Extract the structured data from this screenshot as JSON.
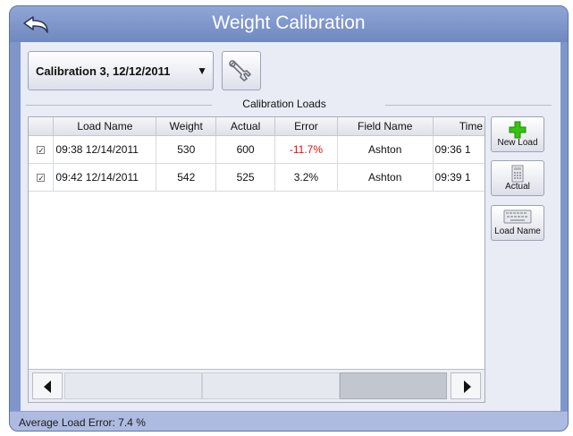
{
  "title": "Weight Calibration",
  "calibration_select": {
    "value": "Calibration 3, 12/12/2011"
  },
  "section_label": "Calibration Loads",
  "table": {
    "columns": [
      "",
      "Load Name",
      "Weight",
      "Actual",
      "Error",
      "Field Name",
      "Time"
    ],
    "rows": [
      {
        "checked": true,
        "load_name": "09:38 12/14/2011",
        "weight": "530",
        "actual": "600",
        "error": "-11.7%",
        "field_name": "Ashton",
        "time": "09:36 1"
      },
      {
        "checked": true,
        "load_name": "09:42 12/14/2011",
        "weight": "542",
        "actual": "525",
        "error": "3.2%",
        "field_name": "Ashton",
        "time": "09:39 1"
      }
    ]
  },
  "side_buttons": {
    "new_load": "New Load",
    "actual": "Actual",
    "load_name": "Load Name"
  },
  "status": "Average Load Error: 7.4 %",
  "icons": {
    "back": "back-arrow-icon",
    "wrench": "wrench-icon",
    "new_load": "green-plus-icon",
    "actual": "calculator-icon",
    "load_name": "keyboard-icon"
  },
  "colors": {
    "frame": "#7e96c9",
    "error_negative": "#e01010",
    "plus_green": "#35c40f"
  }
}
